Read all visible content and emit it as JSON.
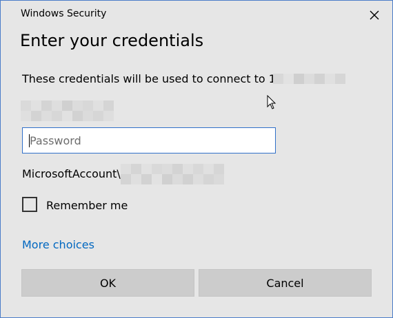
{
  "window": {
    "title": "Windows Security"
  },
  "dialog": {
    "heading": "Enter your credentials",
    "description": "These credentials will be used to connect to 19",
    "password_placeholder": "Password",
    "password_value": "",
    "account_prefix": "MicrosoftAccount\\",
    "remember_label": "Remember me",
    "remember_checked": false,
    "more_choices": "More choices",
    "ok_label": "OK",
    "cancel_label": "Cancel"
  },
  "icons": {
    "close": "close-icon",
    "pointer": "mouse-pointer-icon"
  },
  "colors": {
    "background": "#e6e6e6",
    "border": "#4a7cc8",
    "link": "#0067c0",
    "input_border": "#2f6fc9",
    "button": "#cccccc"
  }
}
